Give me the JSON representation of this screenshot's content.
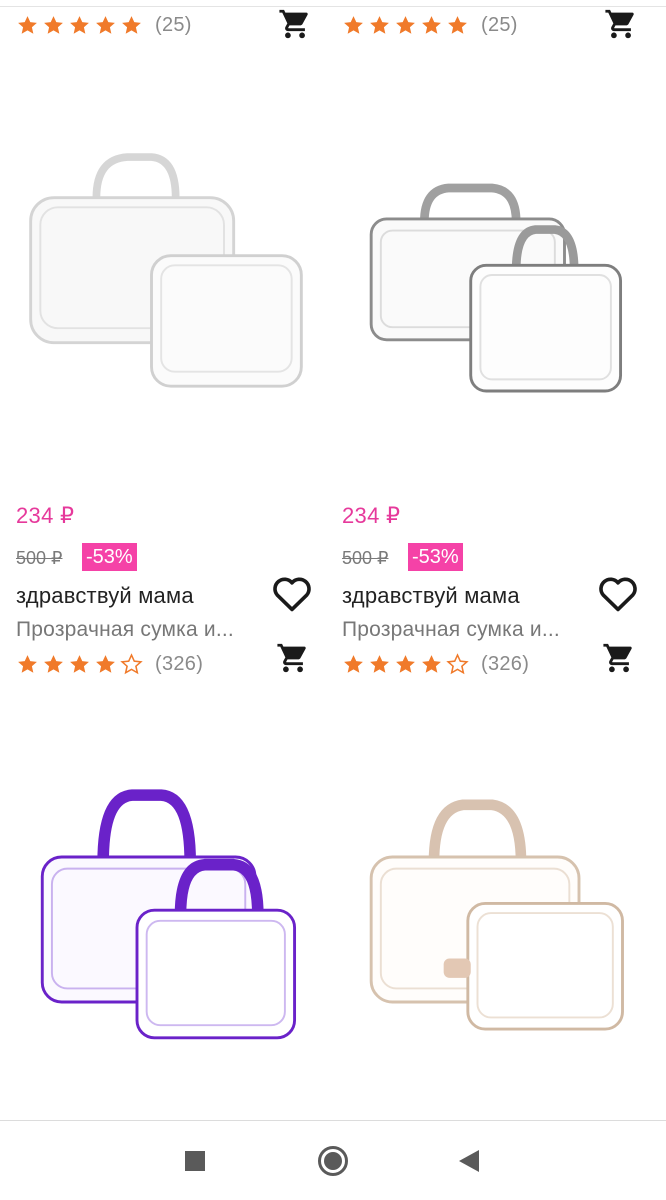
{
  "top_row": {
    "left": {
      "rating": 5,
      "count": "(25)"
    },
    "right": {
      "rating": 5,
      "count": "(25)"
    }
  },
  "products": [
    {
      "price": "234 ₽",
      "old_price": "500 ₽",
      "discount": "-53%",
      "brand": "здравствуй мама",
      "title": "Прозрачная сумка и...",
      "rating": 4,
      "count": "(326)",
      "trim_color": "#d0d0d0"
    },
    {
      "price": "234 ₽",
      "old_price": "500 ₽",
      "discount": "-53%",
      "brand": "здравствуй мама",
      "title": "Прозрачная сумка и...",
      "rating": 4,
      "count": "(326)",
      "trim_color": "#8c8c8c"
    },
    {
      "trim_color": "#6a22c9"
    },
    {
      "trim_color": "#d8c2b0"
    }
  ],
  "icons": {
    "star_filled": "star-filled-icon",
    "star_empty": "star-outline-icon",
    "cart": "shopping-cart-icon",
    "heart": "heart-icon"
  },
  "colors": {
    "star": "#f07a2a",
    "price": "#e6399b",
    "discount_bg": "#f542a7"
  },
  "nav": {
    "buttons": [
      "recents",
      "home",
      "back"
    ]
  }
}
